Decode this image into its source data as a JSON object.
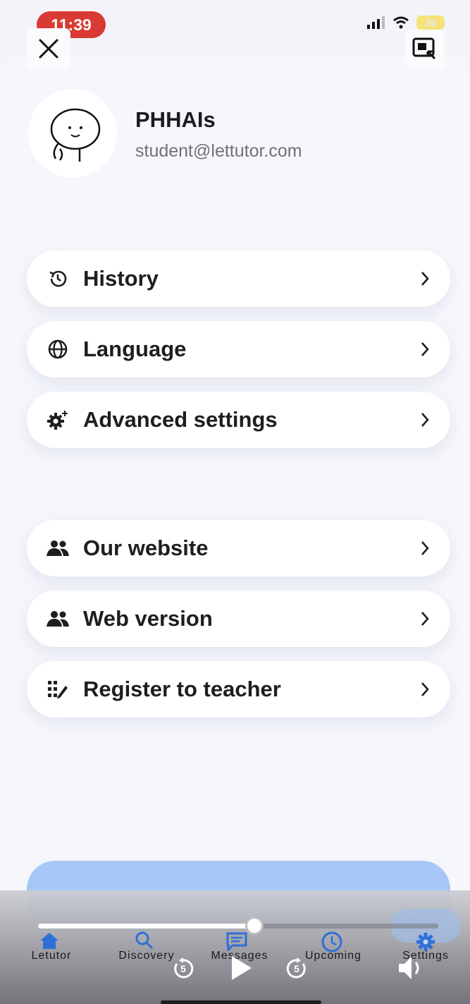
{
  "status": {
    "time": "11:39",
    "battery": "26"
  },
  "profile": {
    "name": "PHHAIs",
    "email": "student@lettutor.com"
  },
  "menu": {
    "group1": [
      {
        "label": "History",
        "icon": "history-icon"
      },
      {
        "label": "Language",
        "icon": "globe-icon"
      },
      {
        "label": "Advanced settings",
        "icon": "gear-sparkle-icon"
      }
    ],
    "group2": [
      {
        "label": "Our website",
        "icon": "people-icon"
      },
      {
        "label": "Web version",
        "icon": "people-icon"
      },
      {
        "label": "Register to teacher",
        "icon": "grid-pen-icon"
      }
    ]
  },
  "bottom_nav": {
    "items": [
      {
        "label": "Letutor",
        "icon": "home-icon"
      },
      {
        "label": "Discovery",
        "icon": "search-icon"
      },
      {
        "label": "Messages",
        "icon": "chat-icon"
      },
      {
        "label": "Upcoming",
        "icon": "clock-icon"
      },
      {
        "label": "Settings",
        "icon": "gear-icon",
        "active": true
      }
    ],
    "active_color": "#2f6fd8"
  },
  "media": {
    "progress": 0.54,
    "skip_back": "5",
    "skip_forward": "5"
  },
  "colors": {
    "accent": "#2f6fd8",
    "logout_bg": "#a7c8f6",
    "time_badge": "#d93a33"
  }
}
